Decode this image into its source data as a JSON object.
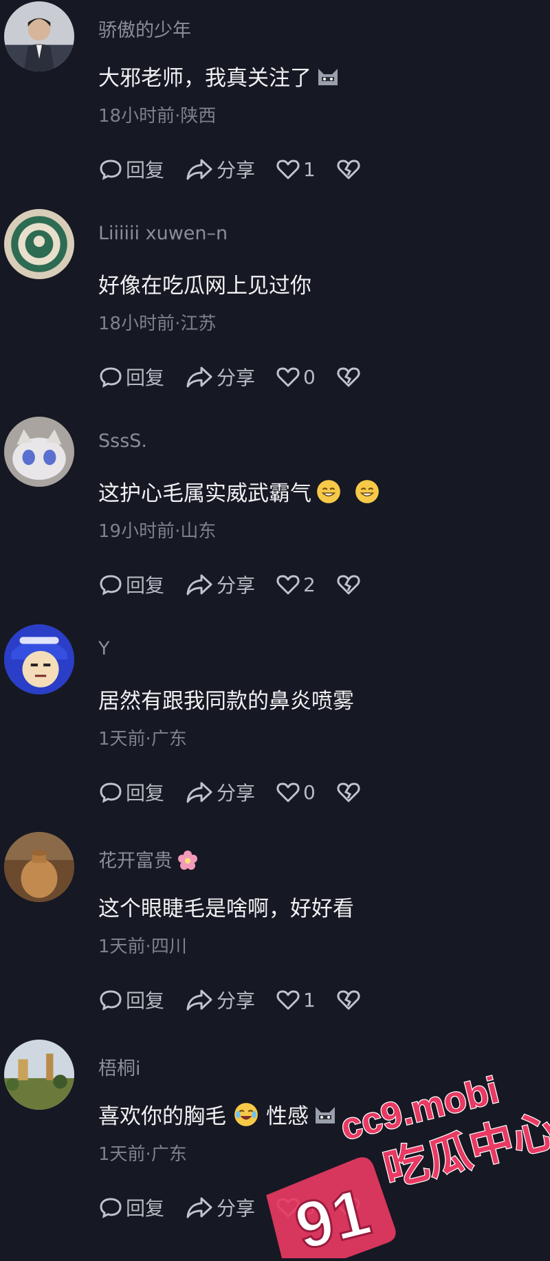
{
  "actions": {
    "reply": "回复",
    "share": "分享"
  },
  "comments": [
    {
      "username": "骄傲的少年",
      "text": "大邪老师，我真关注了",
      "text_suffix": "",
      "time": "18小时前",
      "location": "陕西",
      "likes": "1",
      "avatar": "man-portrait",
      "emojis": [
        "cat-emoji"
      ]
    },
    {
      "username": "Liiiiii xuwen–n",
      "text": "好像在吃瓜网上见过你",
      "text_suffix": "",
      "time": "18小时前",
      "location": "江苏",
      "likes": "0",
      "avatar": "coffee-logo",
      "emojis": []
    },
    {
      "username": "SssS.",
      "text": "这护心毛属实威武霸气",
      "text_suffix": "",
      "time": "19小时前",
      "location": "山东",
      "likes": "2",
      "avatar": "cat-photo",
      "emojis": [
        "grin-emoji",
        "grin-emoji"
      ]
    },
    {
      "username": "Y",
      "text": "居然有跟我同款的鼻炎喷雾",
      "text_suffix": "",
      "time": "1天前",
      "location": "广东",
      "likes": "0",
      "avatar": "cartoon-meme",
      "emojis": []
    },
    {
      "username": "花开富贵",
      "text": "这个眼睫毛是啥啊，好好看",
      "text_suffix": "",
      "time": "1天前",
      "location": "四川",
      "likes": "1",
      "avatar": "pottery",
      "emojis": []
    },
    {
      "username": "梧桐i",
      "text": "喜欢你的胸毛",
      "text_suffix": "性感",
      "time": "1天前",
      "location": "广东",
      "likes": "0",
      "avatar": "landscape",
      "emojis": [
        "laugh-cry-emoji",
        "cat-emoji"
      ]
    }
  ],
  "watermark": {
    "number": "91",
    "domain": "cc9.mobi",
    "slogan": "吃瓜中心"
  },
  "colors": {
    "background": "#161823",
    "text": "#f1f1f3",
    "muted": "#7f818a",
    "watermark": "#e83a63"
  }
}
